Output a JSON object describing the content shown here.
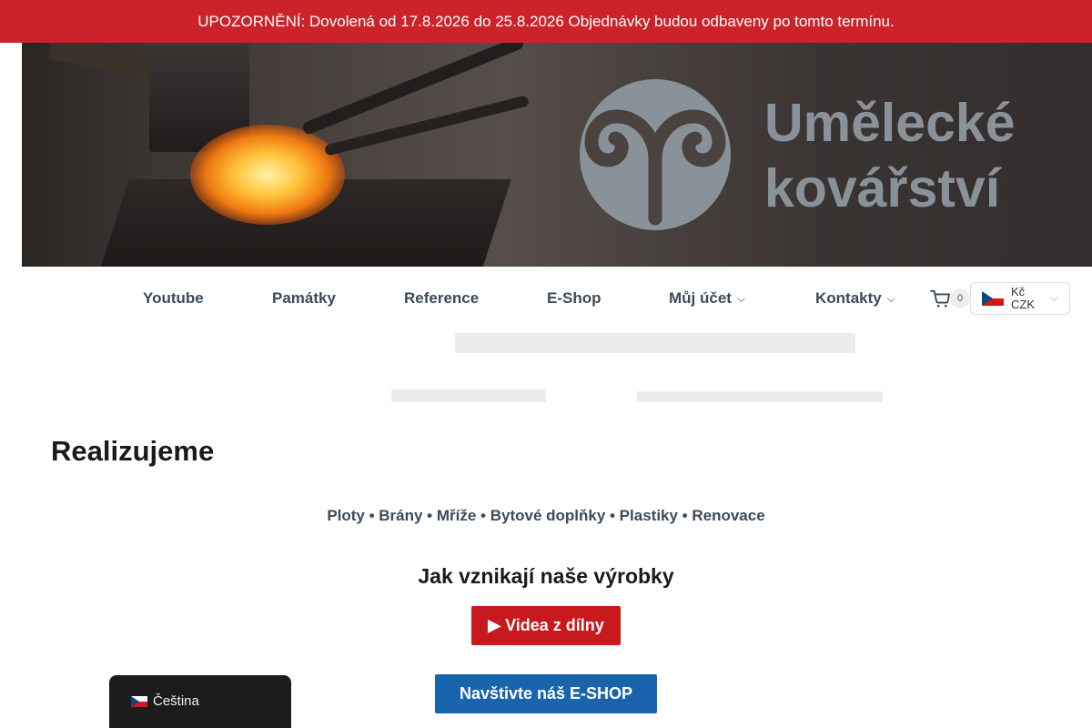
{
  "notice": {
    "text": "UPOZORNĚNÍ: Dovolená od 17.8.2026 do 25.8.2026 Objednávky budou odbaveny po tomto termínu."
  },
  "hero": {
    "brand_line1": "Umělecké",
    "brand_line2": "kovářství",
    "logo_color": "#8a9299"
  },
  "nav": {
    "items": [
      {
        "label": "Youtube"
      },
      {
        "label": "Památky"
      },
      {
        "label": "Reference"
      },
      {
        "label": "E-Shop"
      },
      {
        "label": "Můj účet",
        "has_dropdown": true
      },
      {
        "label": "Kontakty",
        "has_dropdown": true
      }
    ],
    "cart": {
      "count": "0",
      "icon": "shopping-cart-icon"
    },
    "currency": {
      "symbol": "Kč",
      "code": "CZK",
      "flag": "czech-flag-icon"
    }
  },
  "main": {
    "title": "Realizujeme",
    "services": "Ploty • Brány • Mříže • Bytové doplňky • Plastiky • Renovace",
    "howto_icon": "",
    "howto_text": "Jak vznikají naše výrobky",
    "video_button": "▶ Videa z dílny",
    "shop_button_icon": "",
    "shop_button": "Navštivte náš E-SHOP"
  },
  "language_switcher": {
    "label": "Čeština",
    "flag": "czech-flag-icon"
  },
  "colors": {
    "notice_bg": "#cc2229",
    "nav_text": "#3d4a57",
    "btn_red": "#c8191f",
    "btn_blue": "#1a63ad"
  }
}
